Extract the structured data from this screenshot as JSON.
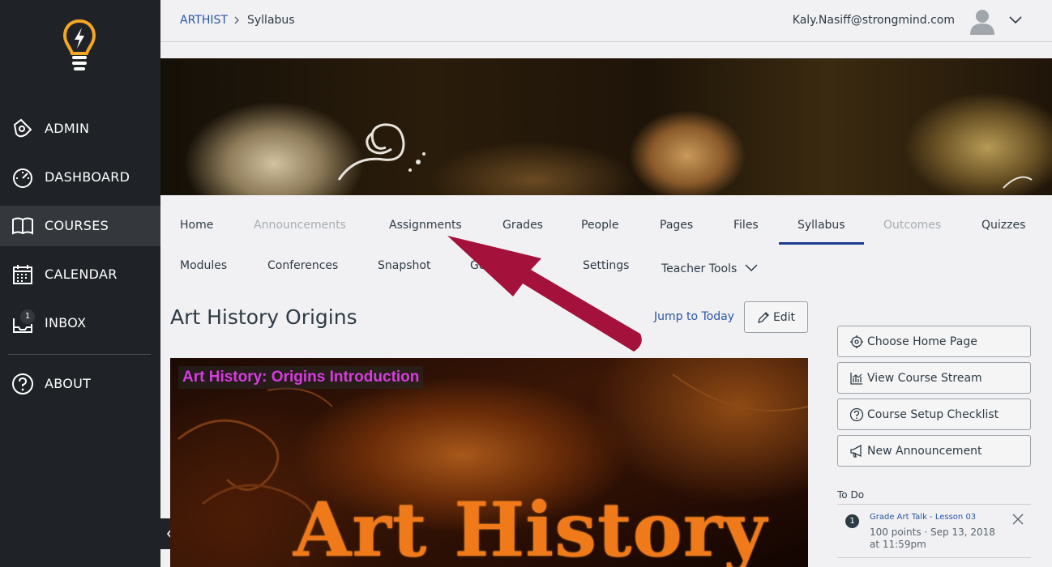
{
  "global_nav": {
    "items": [
      {
        "label": "ADMIN",
        "icon": "admin-shield-icon"
      },
      {
        "label": "DASHBOARD",
        "icon": "dashboard-gauge-icon"
      },
      {
        "label": "COURSES",
        "icon": "courses-book-icon",
        "active": true
      },
      {
        "label": "CALENDAR",
        "icon": "calendar-icon"
      },
      {
        "label": "INBOX",
        "icon": "inbox-icon",
        "badge": "1"
      },
      {
        "label": "ABOUT",
        "icon": "help-circle-icon"
      }
    ]
  },
  "header": {
    "breadcrumb": {
      "course": "ARTHIST",
      "current": "Syllabus"
    },
    "user_email": "Kaly.Nasiff@strongmind.com"
  },
  "course_nav": {
    "row1": [
      {
        "label": "Home"
      },
      {
        "label": "Announcements",
        "disabled": true
      },
      {
        "label": "Assignments"
      },
      {
        "label": "Grades"
      },
      {
        "label": "People"
      },
      {
        "label": "Pages"
      },
      {
        "label": "Files"
      },
      {
        "label": "Syllabus",
        "active": true
      },
      {
        "label": "Outcomes",
        "disabled": true
      },
      {
        "label": "Quizzes"
      }
    ],
    "row2": [
      {
        "label": "Modules"
      },
      {
        "label": "Conferences"
      },
      {
        "label": "Snapshot"
      },
      {
        "label": "Go...ive"
      },
      {
        "label": "Settings"
      },
      {
        "label": "Teacher Tools"
      }
    ]
  },
  "main": {
    "title": "Art History Origins",
    "jump_to_today": "Jump to Today",
    "edit_label": "Edit",
    "media": {
      "caption": "Art History: Origins Introduction",
      "heading": "Art History"
    }
  },
  "sidebar": {
    "buttons": [
      {
        "label": "Choose Home Page",
        "icon": "target-icon"
      },
      {
        "label": "View Course Stream",
        "icon": "stream-chart-icon"
      },
      {
        "label": "Course Setup Checklist",
        "icon": "question-circle-icon"
      },
      {
        "label": "New Announcement",
        "icon": "megaphone-icon"
      }
    ],
    "todo": {
      "title": "To Do",
      "items": [
        {
          "badge": "1",
          "title": "Grade Art Talk - Lesson 03",
          "meta": "100 points · Sep 13, 2018 at 11:59pm"
        }
      ]
    }
  },
  "colors": {
    "nav_bg": "#1f2327",
    "link": "#2a55a6",
    "active_underline": "#1c3c8f",
    "annotation_arrow": "#a4113a",
    "logo": "#f5a623"
  }
}
